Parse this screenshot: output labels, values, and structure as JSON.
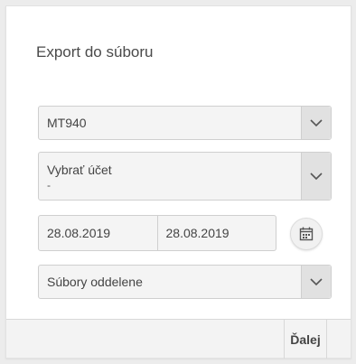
{
  "dialog": {
    "title": "Export do súboru"
  },
  "format_select": {
    "value": "MT940",
    "icon": "chevron-down-icon"
  },
  "account_select": {
    "label": "Vybrať účet",
    "value": "-",
    "icon": "chevron-down-icon"
  },
  "date_range": {
    "from": "28.08.2019",
    "to": "28.08.2019",
    "calendar_icon": "calendar-icon"
  },
  "files_select": {
    "value": "Súbory oddelene",
    "icon": "chevron-down-icon"
  },
  "footer": {
    "next_label": "Ďalej"
  }
}
